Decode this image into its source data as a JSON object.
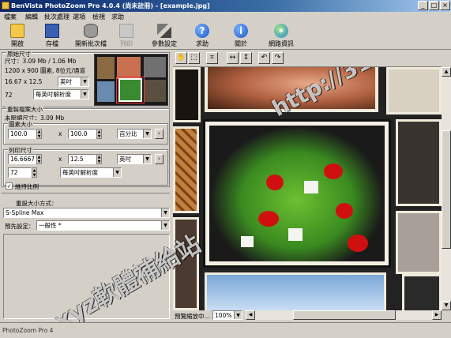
{
  "window": {
    "title": "BenVista PhotoZoom Pro 4.0.4 (尚未註冊) - [example.jpg]",
    "minimize": "_",
    "maximize": "□",
    "close": "×"
  },
  "menu": [
    "檔案",
    "編輯",
    "批次處理",
    "選項",
    "檢視",
    "求助"
  ],
  "toolbar": [
    {
      "label": "開啟",
      "icon": "folder-icon"
    },
    {
      "label": "存檔",
      "icon": "floppy-icon"
    },
    {
      "label": "開新批次檔",
      "icon": "batch-icon"
    },
    {
      "label": "列印",
      "icon": "printer-icon"
    },
    {
      "label": "參數設定",
      "icon": "tools-icon"
    },
    {
      "label": "求助",
      "icon": "help-icon"
    },
    {
      "label": "關於",
      "icon": "info-icon"
    },
    {
      "label": "網路資訊",
      "icon": "globe-icon"
    }
  ],
  "original": {
    "heading": "原始尺寸",
    "size_line": "尺寸：3.09 Mb / 1.06 Mb",
    "pixels": "1200 x 900 圖素, 8位元/通道",
    "dims": "16.67 x 12.5",
    "unit": "英吋",
    "dpi": "72",
    "resolution_unit": "每英吋解析度"
  },
  "new_size": {
    "heading": "重製檔案大小",
    "uncompressed": "未壓縮尺寸：3.09 Mb",
    "pixel_heading": "圖素大小",
    "pct_w": "100.0",
    "pct_h": "100.0",
    "x1": "x",
    "pct_unit": "百分比",
    "print_heading": "列印尺寸",
    "print_w": "16.6667",
    "print_h": "12.5",
    "x2": "x",
    "print_unit": "英吋",
    "dpi": "72",
    "resolution_unit": "每英吋解析度",
    "keep_ratio": "維持比例"
  },
  "method": {
    "heading": "重設大小方式：",
    "value": "S-Spline Max",
    "preset_label": "預先設定：",
    "preset_value": "一般性 *"
  },
  "preview": {
    "zoom_label": "預覽縮放中...",
    "zoom_value": "100%"
  },
  "status": {
    "text": "PhotoZoom Pro 4"
  },
  "watermark": {
    "url": "http://31.to",
    "text": "xyz軟體補給站"
  }
}
